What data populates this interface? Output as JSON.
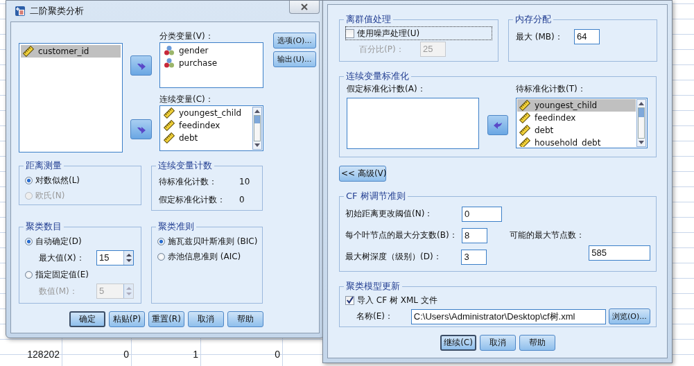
{
  "spreadsheet_row": [
    "128202",
    "0",
    "1",
    "0"
  ],
  "left_dialog": {
    "title": "二阶聚类分析",
    "source_variables": [
      {
        "name": "customer_id",
        "kind": "scale",
        "selected": true
      }
    ],
    "categorical_label": "分类变量(V)：",
    "categorical_variables": [
      {
        "name": "gender",
        "kind": "nominal"
      },
      {
        "name": "purchase",
        "kind": "nominal"
      }
    ],
    "continuous_label": "连续变量(C)：",
    "continuous_variables": [
      {
        "name": "youngest_child",
        "kind": "scale"
      },
      {
        "name": "feedindex",
        "kind": "scale"
      },
      {
        "name": "debt",
        "kind": "scale"
      }
    ],
    "side_buttons": [
      "选项(O)...",
      "输出(U)..."
    ],
    "distance": {
      "title": "距离测量",
      "options": [
        {
          "label": "对数似然(L)",
          "selected": true,
          "disabled": false
        },
        {
          "label": "欧氏(N)",
          "selected": false,
          "disabled": true
        }
      ]
    },
    "counts": {
      "title": "连续变量计数",
      "rows": [
        {
          "label": "待标准化计数：",
          "value": "10"
        },
        {
          "label": "假定标准化计数：",
          "value": "0"
        }
      ]
    },
    "cluster_count": {
      "title": "聚类数目",
      "options": [
        {
          "label": "自动确定(D)",
          "selected": true,
          "field_label": "最大值(X)：",
          "value": "15"
        },
        {
          "label": "指定固定值(E)",
          "selected": false,
          "field_label": "数值(M)：",
          "value": "5"
        }
      ]
    },
    "criterion": {
      "title": "聚类准则",
      "options": [
        {
          "label": "施瓦兹贝叶斯准则 (BIC)",
          "selected": true
        },
        {
          "label": "赤池信息准则 (AIC)",
          "selected": false
        }
      ]
    },
    "buttons": [
      {
        "label": "确定",
        "default": true
      },
      {
        "label": "粘贴(P)",
        "default": false
      },
      {
        "label": "重置(R)",
        "default": false
      },
      {
        "label": "取消",
        "default": false
      },
      {
        "label": "帮助",
        "default": false
      }
    ]
  },
  "right_dialog": {
    "outliers": {
      "title": "离群值处理",
      "checkbox": {
        "label": "使用噪声处理(U)",
        "checked": false
      },
      "percent_label": "百分比(P)：",
      "percent_value": "25"
    },
    "memory": {
      "title": "内存分配",
      "label": "最大 (MB)：",
      "value": "64"
    },
    "standardize": {
      "title": "连续变量标准化",
      "assumed_label": "假定标准化计数(A)：",
      "pending_label": "待标准化计数(T)：",
      "pending_variables": [
        {
          "name": "youngest_child",
          "selected": true
        },
        {
          "name": "feedindex",
          "selected": false
        },
        {
          "name": "debt",
          "selected": false
        },
        {
          "name": "household_debt",
          "selected": false
        }
      ]
    },
    "advanced_button": "<< 高级(V)",
    "cf_tree": {
      "title": "CF 树调节准则",
      "fields": [
        {
          "label": "初始距离更改阈值(N)：",
          "value": "0"
        },
        {
          "label": "每个叶节点的最大分支数(B)：",
          "value": "8"
        },
        {
          "label": "最大树深度（级别）(D)：",
          "value": "3"
        }
      ],
      "max_nodes_label": "可能的最大节点数：",
      "max_nodes_value": "585"
    },
    "model_update": {
      "title": "聚类模型更新",
      "checkbox": {
        "label": "导入 CF 树 XML 文件",
        "checked": true
      },
      "name_label": "名称(E)：",
      "path": "C:\\Users\\Administrator\\Desktop\\cf树.xml",
      "browse_button": "浏览(O)..."
    },
    "buttons": [
      {
        "label": "继续(C)",
        "default": true
      },
      {
        "label": "取消",
        "default": false
      },
      {
        "label": "帮助",
        "default": false
      }
    ]
  }
}
